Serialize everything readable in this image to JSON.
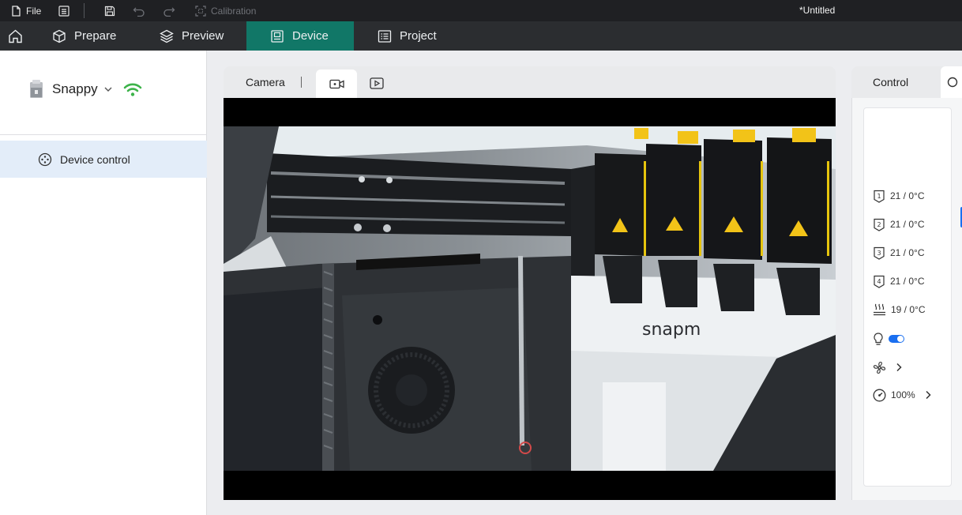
{
  "titlebar": {
    "file_label": "File",
    "calibration_label": "Calibration",
    "document_title": "*Untitled"
  },
  "nav": {
    "prepare": "Prepare",
    "preview": "Preview",
    "device": "Device",
    "project": "Project"
  },
  "sidebar": {
    "device_name": "Snappy",
    "menu": [
      {
        "label": "Device control",
        "selected": true
      }
    ]
  },
  "camera": {
    "tab_label": "Camera",
    "brand_text": "snapm"
  },
  "control": {
    "tab_label": "Control",
    "extruders": [
      {
        "index": "1",
        "temp": "21 / 0°C"
      },
      {
        "index": "2",
        "temp": "21 / 0°C"
      },
      {
        "index": "3",
        "temp": "21 / 0°C"
      },
      {
        "index": "4",
        "temp": "21 / 0°C"
      }
    ],
    "bed_temp": "19 / 0°C",
    "light_on": true,
    "speed": "100%"
  },
  "colors": {
    "accent_teal": "#117767",
    "toggle_blue": "#1a6ff0",
    "wifi_green": "#3db34a",
    "selected_bg": "#e3edf9"
  }
}
